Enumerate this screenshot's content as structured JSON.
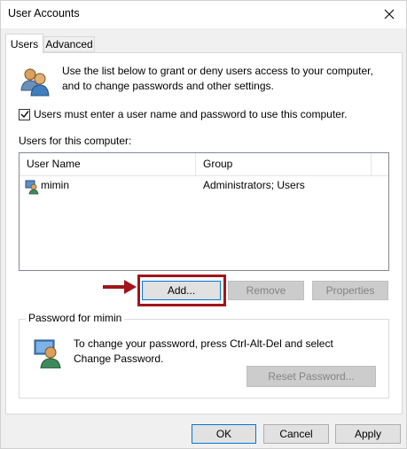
{
  "window": {
    "title": "User Accounts"
  },
  "tabs": [
    {
      "label": "Users",
      "selected": true
    },
    {
      "label": "Advanced",
      "selected": false
    }
  ],
  "intro": {
    "text": "Use the list below to grant or deny users access to your computer, and to change passwords and other settings."
  },
  "require_login": {
    "label": "Users must enter a user name and password to use this computer.",
    "checked": true
  },
  "users_list": {
    "label": "Users for this computer:",
    "columns": [
      "User Name",
      "Group"
    ],
    "rows": [
      {
        "user_name": "mimin",
        "group": "Administrators; Users",
        "icon": "user-icon"
      }
    ]
  },
  "list_buttons": {
    "add": "Add...",
    "remove": "Remove",
    "properties": "Properties"
  },
  "password_group": {
    "label": "Password for mimin",
    "text": "To change your password, press Ctrl-Alt-Del and select Change Password.",
    "reset_button": "Reset Password..."
  },
  "dialog_buttons": {
    "ok": "OK",
    "cancel": "Cancel",
    "apply": "Apply"
  },
  "colors": {
    "highlight": "#a0151c",
    "accent": "#0078d7"
  }
}
